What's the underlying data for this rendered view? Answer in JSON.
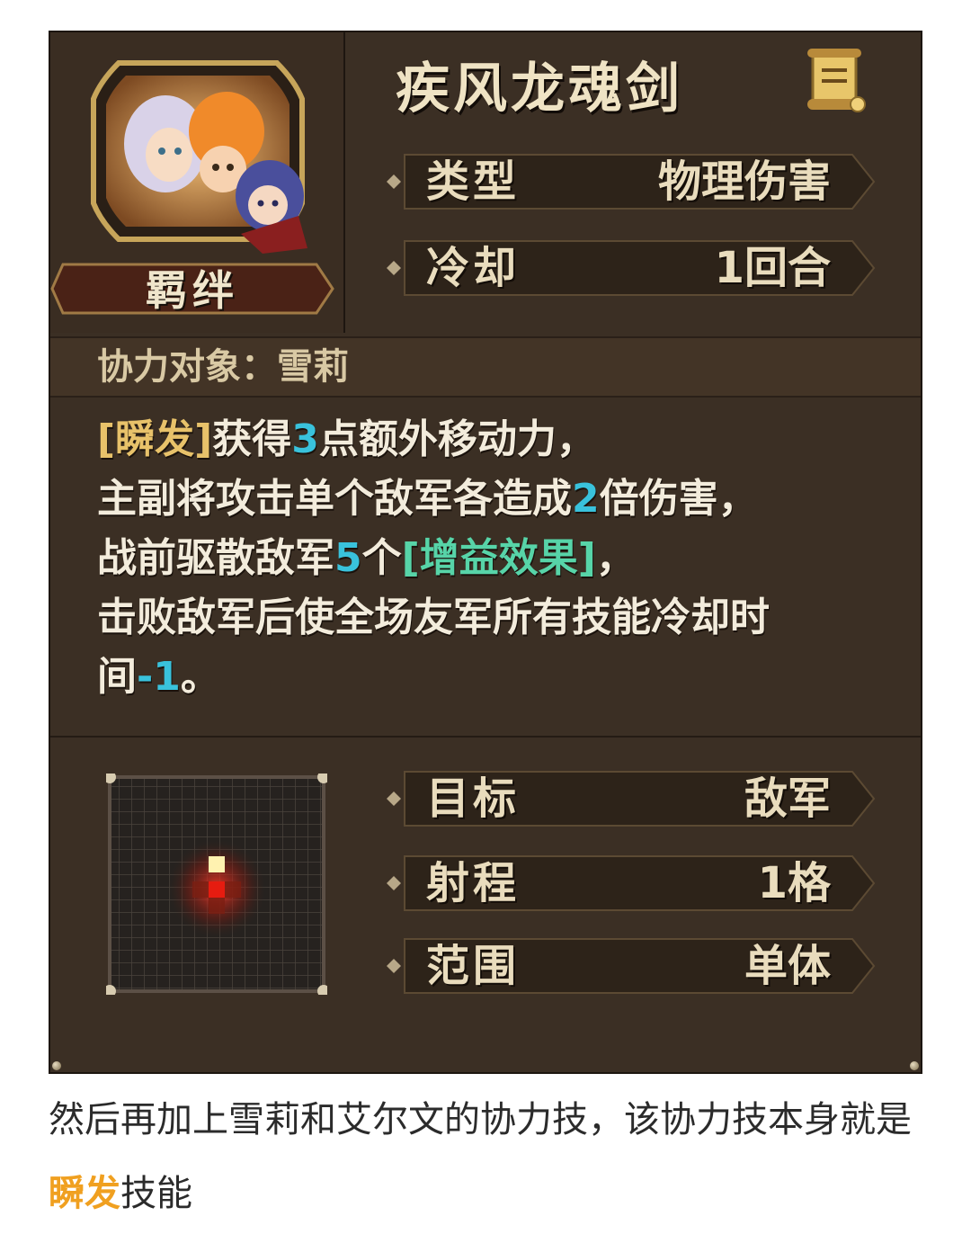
{
  "skill": {
    "name": "疾风龙魂剑",
    "bond_label": "羁绊",
    "partner": "协力对象：雪莉",
    "stats_top": [
      {
        "key": "类型",
        "value": "物理伤害"
      },
      {
        "key": "冷却",
        "value": "1回合"
      }
    ],
    "description": {
      "line1": {
        "tag": "[瞬发]",
        "pre": "获得",
        "num": "3",
        "post": "点额外移动力，"
      },
      "line2": {
        "pre": "主副将攻击单个敌军各造成",
        "num": "2",
        "post": "倍伤害，"
      },
      "line3": {
        "pre": "战前驱散敌军",
        "num": "5",
        "mid": "个",
        "buff": "[增益效果]",
        "post": "，"
      },
      "line4": {
        "text": "击败敌军后使全场友军所有技能冷却时"
      },
      "line5": {
        "pre": "间",
        "num": "-1",
        "post": "。"
      }
    },
    "stats_bottom": [
      {
        "key": "目标",
        "value": "敌军"
      },
      {
        "key": "射程",
        "value": "1格"
      },
      {
        "key": "范围",
        "value": "单体"
      }
    ]
  },
  "footer": {
    "pre": "然后再加上雪莉和艾尔文的协力技，该协力技本身就是",
    "highlight": "瞬发",
    "post": "技能"
  },
  "colors": {
    "panel": "#3b2f24",
    "gold_text": "#e9dcbd",
    "number_cyan": "#39c2dc",
    "buff_green": "#57d4a8",
    "tag_gold": "#e8c26a",
    "footer_highlight": "#f0a020"
  }
}
